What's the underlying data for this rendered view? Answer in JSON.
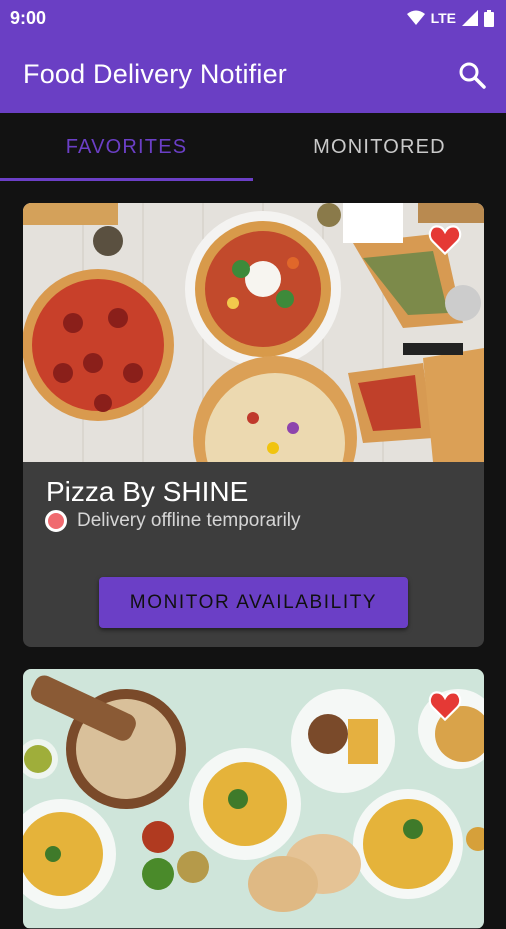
{
  "status_bar": {
    "time": "9:00",
    "network": "LTE"
  },
  "app_bar": {
    "title": "Food Delivery Notifier",
    "search_icon": "search-icon"
  },
  "tabs": [
    {
      "label": "FAVORITES",
      "active": true
    },
    {
      "label": "MONITORED",
      "active": false
    }
  ],
  "restaurants": [
    {
      "name": "Pizza By SHINE",
      "status": "Delivery offline temporarily",
      "status_color": "#f06a6f",
      "favorite": true,
      "button_label": "MONITOR AVAILABILITY"
    },
    {
      "favorite": true
    }
  ],
  "colors": {
    "primary": "#6a3fc4",
    "background": "#121212",
    "card": "#3d3d3d",
    "heart": "#e53935"
  }
}
